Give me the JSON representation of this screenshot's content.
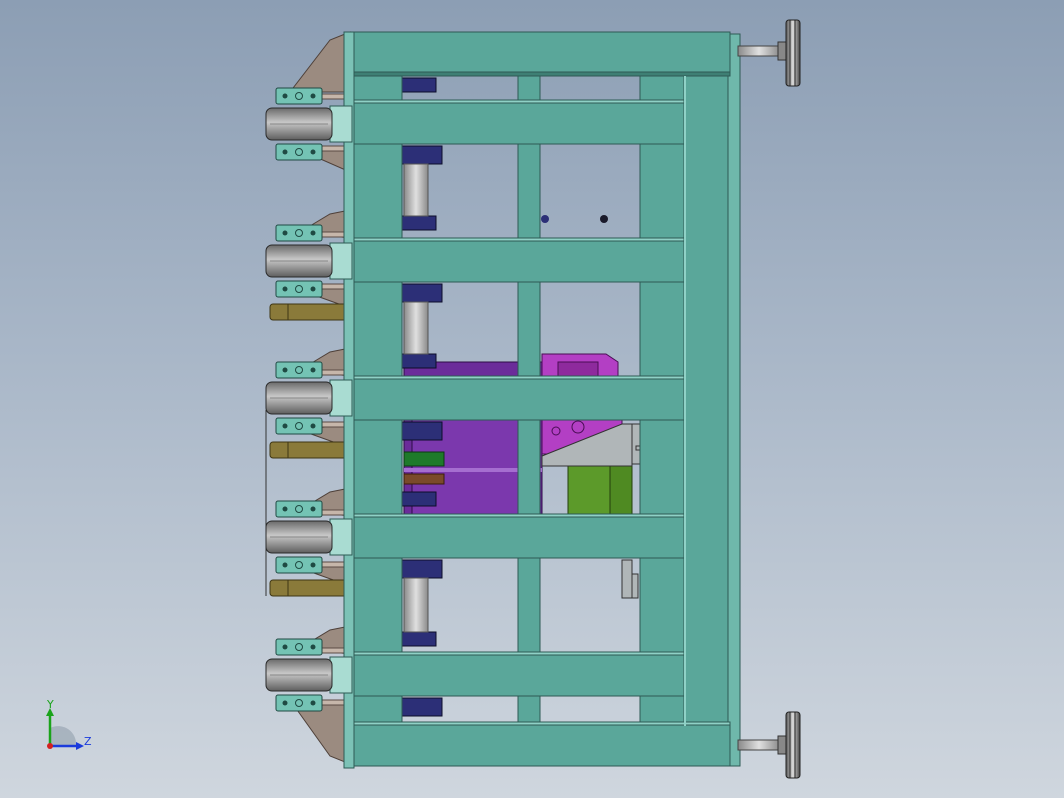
{
  "viewport": {
    "background_top": "#8c9eb4",
    "background_bottom": "#cfd6de"
  },
  "colors": {
    "frame": "#5aa79a",
    "frame_edge": "#2d5a54",
    "frame_light": "#8fd1c6",
    "bracket": "#9b8b80",
    "roller": "#8f8f8f",
    "bearing": "#74c3b4",
    "cylinder_body": "#2c2f77",
    "piston": "#b7b7b7",
    "gearbox": "#6b2c9a",
    "motor": "#b33fc4",
    "plate_green": "#5c9a2a",
    "clamp_pad": "#8a7a3a",
    "foot": "#6e6e6e"
  },
  "triad": {
    "y_label": "Y",
    "z_label": "Z",
    "y_color": "#1aa31a",
    "z_color": "#1b3bdc",
    "x_color": "#d42020"
  }
}
